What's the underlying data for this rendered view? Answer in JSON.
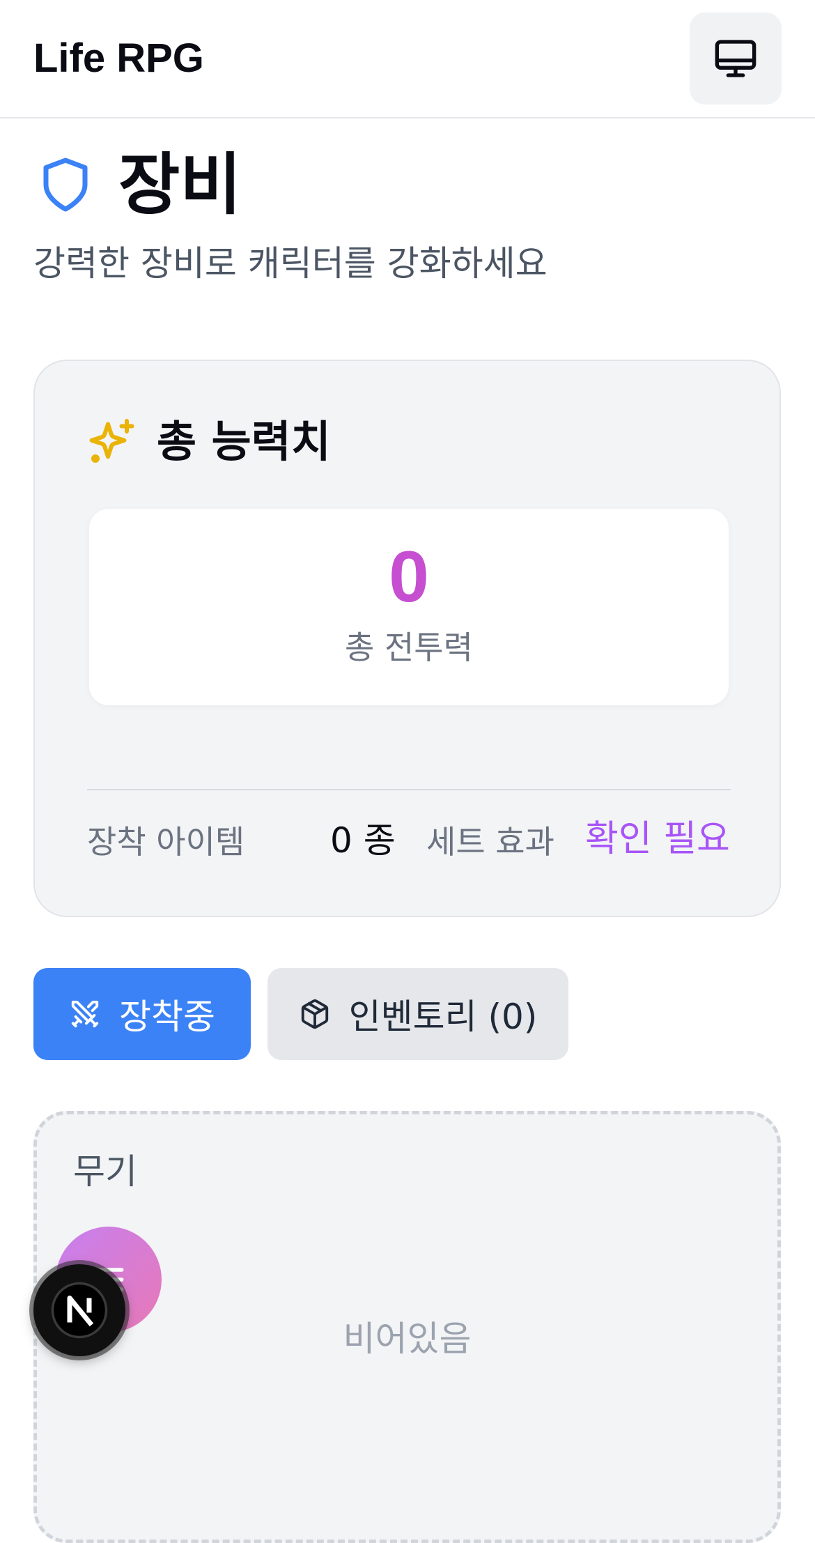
{
  "header": {
    "app_title": "Life RPG",
    "theme_toggle_icon": "monitor-icon"
  },
  "page": {
    "title": "장비",
    "title_icon": "shield-icon",
    "subtitle": "강력한 장비로 캐릭터를 강화하세요"
  },
  "stats_card": {
    "title": "총 능력치",
    "title_icon": "sparkles-icon",
    "total_power_value": "0",
    "total_power_label": "총 전투력",
    "equipped_items_label": "장착 아이템",
    "equipped_items_count": "0 종",
    "set_effect_label": "세트 효과",
    "set_effect_value": "확인 필요"
  },
  "tabs": [
    {
      "label": "장착중",
      "icon": "swords-icon",
      "active": true
    },
    {
      "label": "인벤토리 (0)",
      "icon": "package-icon",
      "active": false
    }
  ],
  "slots": [
    {
      "label": "무기",
      "empty_text": "비어있음"
    }
  ],
  "floating": {
    "menu_icon": "menu-icon",
    "dev_badge_icon": "nextjs-logo-icon"
  },
  "colors": {
    "accent_blue": "#3b82f6",
    "power_purple": "#c64ed0",
    "set_purple": "#a855f7",
    "sparkle_gold": "#eab308"
  }
}
